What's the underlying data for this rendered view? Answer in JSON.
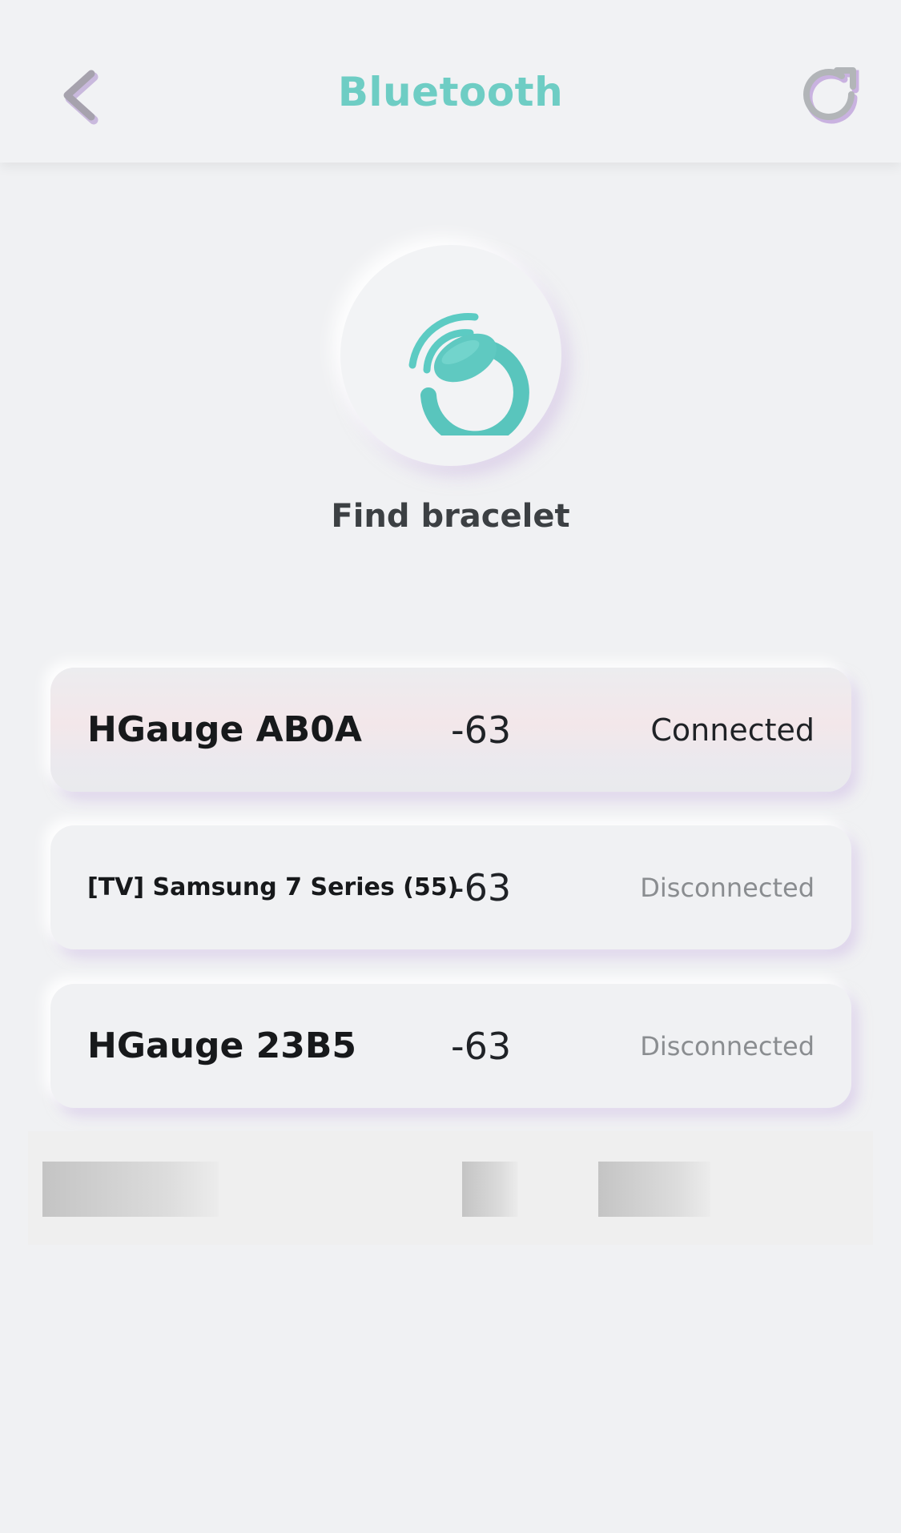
{
  "header": {
    "title": "Bluetooth",
    "back_icon": "chevron-left-icon",
    "refresh_icon": "refresh-icon"
  },
  "find": {
    "label": "Find bracelet",
    "icon": "bracelet-signal-icon"
  },
  "devices": [
    {
      "name": "HGauge AB0A",
      "rssi": "-63",
      "status": "Connected"
    },
    {
      "name": "[TV] Samsung 7 Series (55)",
      "rssi": "-63",
      "status": "Disconnected"
    },
    {
      "name": "HGauge 23B5",
      "rssi": "-63",
      "status": "Disconnected"
    }
  ],
  "colors": {
    "accent": "#6ecdc4",
    "icon_purple": "#b9a7d2",
    "background": "#f0f1f3"
  }
}
